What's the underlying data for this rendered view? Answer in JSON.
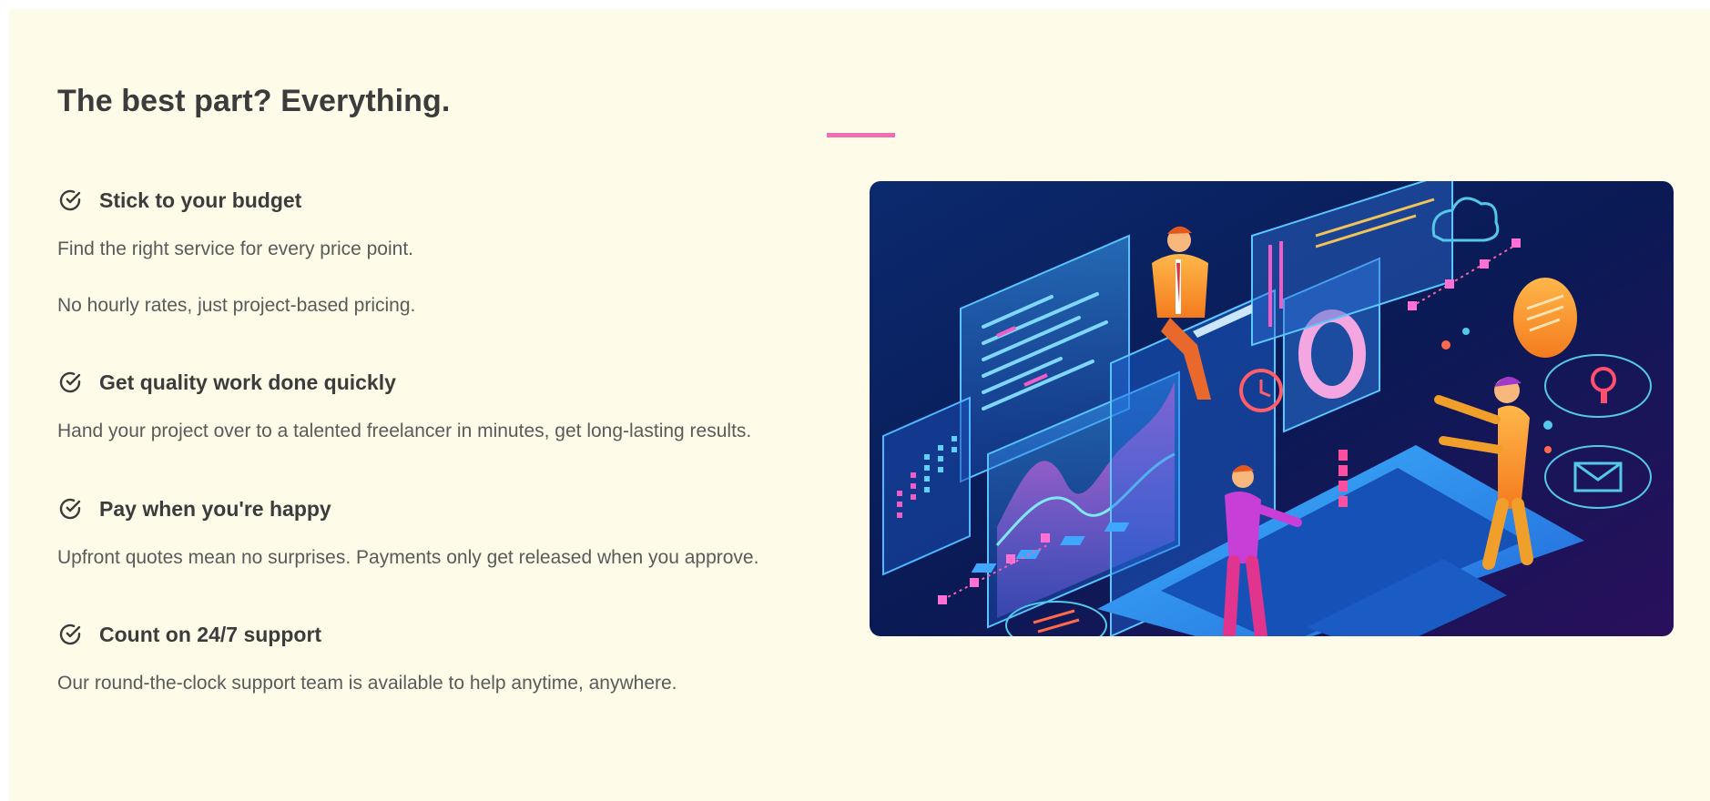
{
  "page": {
    "title": "The best part? Everything.",
    "accent_color": "#ef6fb6",
    "background_color": "#fefce8",
    "text_color": "#3c3c3c"
  },
  "features": [
    {
      "icon": "check-circle-icon",
      "title": "Stick to your budget",
      "lines": [
        "Find the right service for every price point.",
        "No hourly rates, just project-based pricing."
      ]
    },
    {
      "icon": "check-circle-icon",
      "title": "Get quality work done quickly",
      "lines": [
        "Hand your project over to a talented freelancer in minutes, get long-lasting results."
      ]
    },
    {
      "icon": "check-circle-icon",
      "title": "Pay when you're happy",
      "lines": [
        "Upfront quotes mean no surprises. Payments only get released when you approve."
      ]
    },
    {
      "icon": "check-circle-icon",
      "title": "Count on 24/7 support",
      "lines": [
        "Our round-the-clock support team is available to help anytime, anywhere."
      ]
    }
  ],
  "illustration": {
    "icon": "isometric-tech-illustration"
  }
}
